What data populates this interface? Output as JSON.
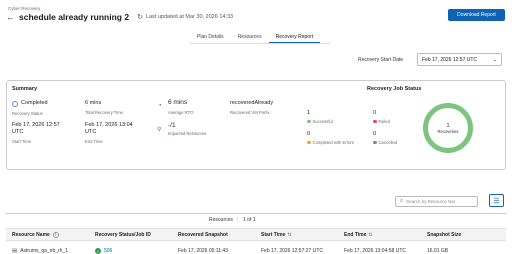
{
  "header": {
    "breadcrumb": "Cyber Recovery",
    "title": "schedule already running 2",
    "last_updated": "Last updated at Mar 30, 2026 14:33",
    "download_button": "Download Report"
  },
  "tabs": [
    {
      "label": "Plan Details",
      "active": false
    },
    {
      "label": "Resources",
      "active": false
    },
    {
      "label": "Recovery Report",
      "active": true
    }
  ],
  "start_date": {
    "label": "Recovery Start Date",
    "value": "Feb 17, 2026 12:57 UTC"
  },
  "summary": {
    "title": "Summary",
    "status_value": "Completed",
    "status_label": "Recovery Status",
    "total_time_value": "6 mins",
    "total_time_label": "Total Recovery Time",
    "rto_value": "6 mins",
    "rto_label": "Average RTO",
    "prefix_value": "recoveredAlready",
    "prefix_label": "Recovered VM Prefix",
    "start_time_value": "Feb 17, 2026 12:57 UTC",
    "start_time_label": "Start Time",
    "end_time_value": "Feb 17, 2026 13:04 UTC",
    "end_time_label": "End Time",
    "impacted_value": "-/1",
    "impacted_label": "Impacted Resources"
  },
  "job_status": {
    "title": "Recovery Job Status",
    "successful_count": "1",
    "successful_label": "Successful",
    "errors_count": "0",
    "errors_label": "Completed with Errors",
    "failed_count": "0",
    "failed_label": "Failed",
    "cancelled_count": "0",
    "cancelled_label": "Cancelled",
    "donut_count": "1",
    "donut_label": "Recoveries",
    "colors": {
      "success": "#7cc47f",
      "errors": "#f0a830",
      "failed": "#e05050",
      "cancelled": "#888888"
    }
  },
  "search": {
    "placeholder": "Search by Resource Nar"
  },
  "table": {
    "count_label": "Resources",
    "count_value": "1 of 1",
    "columns": [
      "Resource Name",
      "Recovery Status/Job ID",
      "Recovered Snapshot",
      "Start Time",
      "End Time",
      "Snapshot Size"
    ],
    "rows": [
      {
        "resource_name": "Astrums_qa_nb_rh_1",
        "job_id": "506",
        "recovered_snapshot": "Feb 17, 2026 05:11:43",
        "start_time": "Feb 17, 2026 12:57:27 UTC",
        "end_time": "Feb 17, 2026 13:04:58 UTC",
        "snapshot_size": "16.01 GB"
      }
    ]
  },
  "colors": {
    "accent": "#0f62b4",
    "success_badge": "#2e9e4e"
  }
}
